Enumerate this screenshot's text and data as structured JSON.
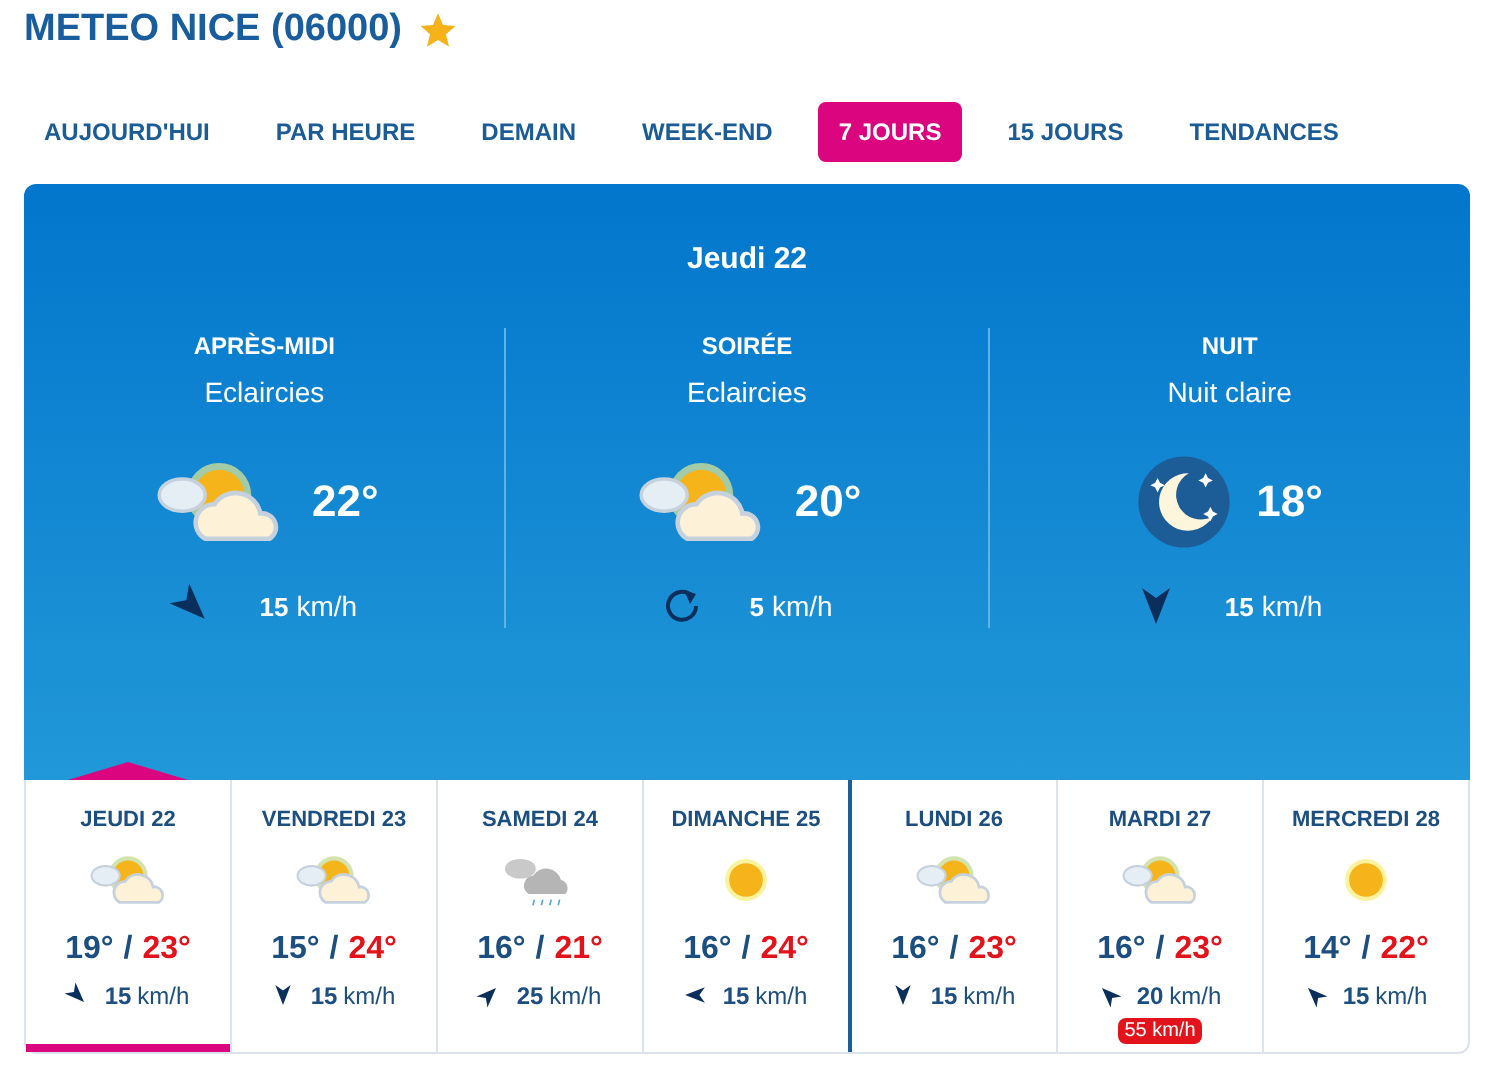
{
  "header": {
    "title": "METEO NICE (06000)",
    "favorite": true
  },
  "tabs": [
    {
      "label": "AUJOURD'HUI",
      "selected": false
    },
    {
      "label": "PAR HEURE",
      "selected": false
    },
    {
      "label": "DEMAIN",
      "selected": false
    },
    {
      "label": "WEEK-END",
      "selected": false
    },
    {
      "label": "7 JOURS",
      "selected": true
    },
    {
      "label": "15 JOURS",
      "selected": false
    },
    {
      "label": "TENDANCES",
      "selected": false
    }
  ],
  "detail": {
    "date": "Jeudi 22",
    "periods": [
      {
        "kind": "cloudsun",
        "name": "APRÈS-MIDI",
        "condition": "Eclaircies",
        "temp": "22°",
        "wind": {
          "kind": "southeast",
          "speed": "15",
          "unit": "km/h"
        }
      },
      {
        "kind": "cloudsun",
        "name": "SOIRÉE",
        "condition": "Eclaircies",
        "temp": "20°",
        "wind": {
          "kind": "variable",
          "speed": "5",
          "unit": "km/h"
        }
      },
      {
        "kind": "moon",
        "name": "NUIT",
        "condition": "Nuit claire",
        "temp": "18°",
        "wind": {
          "kind": "south",
          "speed": "15",
          "unit": "km/h"
        }
      }
    ]
  },
  "days": [
    {
      "kind": "cloudsun",
      "label": "JEUDI 22",
      "selected": true,
      "week_start": false,
      "min": "19°",
      "separator": "/",
      "max": "23°",
      "wind": {
        "kind": "southeast",
        "speed": "15",
        "unit": "km/h"
      }
    },
    {
      "kind": "cloudsun",
      "label": "VENDREDI 23",
      "selected": false,
      "week_start": false,
      "min": "15°",
      "separator": "/",
      "max": "24°",
      "wind": {
        "kind": "south",
        "speed": "15",
        "unit": "km/h"
      }
    },
    {
      "kind": "rain",
      "label": "SAMEDI 24",
      "selected": false,
      "week_start": false,
      "min": "16°",
      "separator": "/",
      "max": "21°",
      "wind": {
        "kind": "northeast",
        "speed": "25",
        "unit": "km/h"
      }
    },
    {
      "kind": "sun",
      "label": "DIMANCHE 25",
      "selected": false,
      "week_start": false,
      "min": "16°",
      "separator": "/",
      "max": "24°",
      "wind": {
        "kind": "west",
        "speed": "15",
        "unit": "km/h"
      }
    },
    {
      "kind": "cloudsun",
      "label": "LUNDI 26",
      "selected": false,
      "week_start": true,
      "min": "16°",
      "separator": "/",
      "max": "23°",
      "wind": {
        "kind": "south",
        "speed": "15",
        "unit": "km/h"
      }
    },
    {
      "kind": "cloudsun",
      "label": "MARDI 27",
      "selected": false,
      "week_start": false,
      "min": "16°",
      "separator": "/",
      "max": "23°",
      "wind": {
        "kind": "northwest",
        "speed": "20",
        "unit": "km/h"
      },
      "gust": "55 km/h"
    },
    {
      "kind": "sun",
      "label": "MERCREDI 28",
      "selected": false,
      "week_start": false,
      "min": "14°",
      "separator": "/",
      "max": "22°",
      "wind": {
        "kind": "northwest",
        "speed": "15",
        "unit": "km/h"
      }
    }
  ]
}
